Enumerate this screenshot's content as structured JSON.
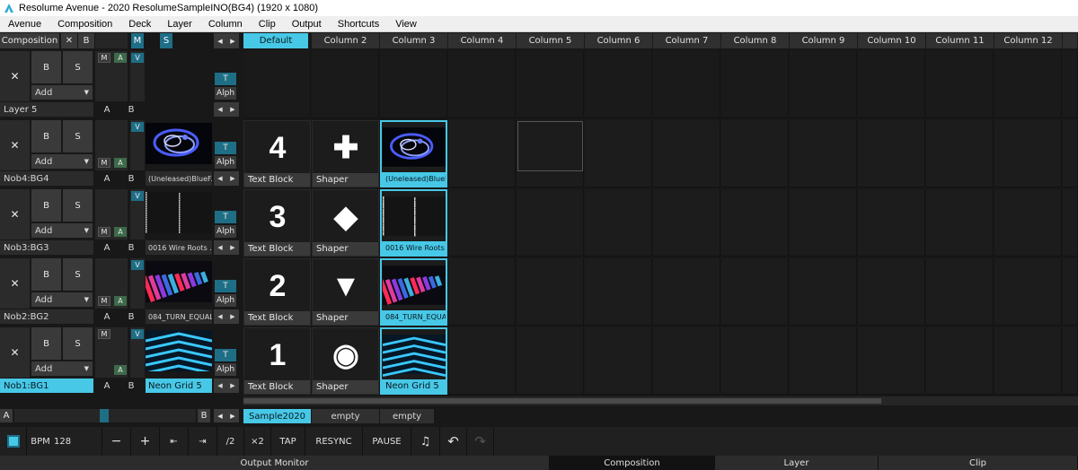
{
  "window": {
    "title": "Resolume Avenue - 2020 ResolumeSampleINO(BG4) (1920 x 1080)"
  },
  "menu": [
    "Avenue",
    "Composition",
    "Deck",
    "Layer",
    "Column",
    "Clip",
    "Output",
    "Shortcuts",
    "View"
  ],
  "comp_header": {
    "label": "Composition",
    "close": "✕",
    "b": "B",
    "m": "M",
    "s": "S",
    "prev": "◀",
    "next": "▶"
  },
  "columns": [
    "Default",
    "Column 2",
    "Column 3",
    "Column 4",
    "Column 5",
    "Column 6",
    "Column 7",
    "Column 8",
    "Column 9",
    "Column 10",
    "Column 11",
    "Column 12"
  ],
  "layer_controls": {
    "close": "✕",
    "b": "B",
    "s": "S",
    "add": "Add",
    "m": "M",
    "a": "A",
    "v": "V",
    "t": "T",
    "alph": "Alph",
    "ab_a": "A",
    "ab_b": "B",
    "prev": "◀",
    "next": "▶"
  },
  "layers": [
    {
      "name": "Layer 5",
      "thumb": "",
      "thumb_label": "",
      "active": false
    },
    {
      "name": "Nob4:BG4",
      "thumb": "swirl",
      "thumb_label": "(Uneleased)BlueF...",
      "active": false
    },
    {
      "name": "Nob3:BG3",
      "thumb": "noise",
      "thumb_label": "0016 Wire Roots ...",
      "active": false
    },
    {
      "name": "Nob2:BG2",
      "thumb": "bars",
      "thumb_label": "084_TURN_EQUAL...",
      "active": false
    },
    {
      "name": "Nob1:BG1",
      "thumb": "chevron",
      "thumb_label": "Neon Grid 5",
      "active": true
    }
  ],
  "clips": [
    [],
    [
      {
        "glyph": "4",
        "label": "Text Block"
      },
      {
        "glyph": "✚",
        "label": "Shaper"
      },
      {
        "thumb": "swirl",
        "label": "(Uneleased)BlueF..."
      }
    ],
    [
      {
        "glyph": "3",
        "label": "Text Block"
      },
      {
        "glyph": "◆",
        "label": "Shaper"
      },
      {
        "thumb": "noise",
        "label": "0016 Wire Roots ..."
      }
    ],
    [
      {
        "glyph": "2",
        "label": "Text Block"
      },
      {
        "glyph": "▼",
        "label": "Shaper"
      },
      {
        "thumb": "bars",
        "label": "084_TURN_EQUAL..."
      }
    ],
    [
      {
        "glyph": "1",
        "label": "Text Block"
      },
      {
        "glyph": "◉",
        "label": "Shaper"
      },
      {
        "thumb": "chevron",
        "label": "Neon Grid 5"
      }
    ]
  ],
  "decks_bar": {
    "a": "A",
    "b": "B",
    "decks": [
      "Sample2020",
      "empty",
      "empty"
    ]
  },
  "transport": {
    "bpm_label": "BPM",
    "bpm_value": "128",
    "minus": "−",
    "plus": "+",
    "nudge_left": "⇤",
    "nudge_right": "⇥",
    "half": "/2",
    "double": "×2",
    "tap": "TAP",
    "resync": "RESYNC",
    "pause": "PAUSE",
    "metronome": "♫",
    "undo": "↶",
    "redo": "↷"
  },
  "bottom_tabs": [
    "Output Monitor",
    "Composition",
    "Layer",
    "Clip"
  ],
  "colors": {
    "accent": "#47c8e6",
    "green": "#3d6a4a",
    "teal": "#1e6e86"
  }
}
